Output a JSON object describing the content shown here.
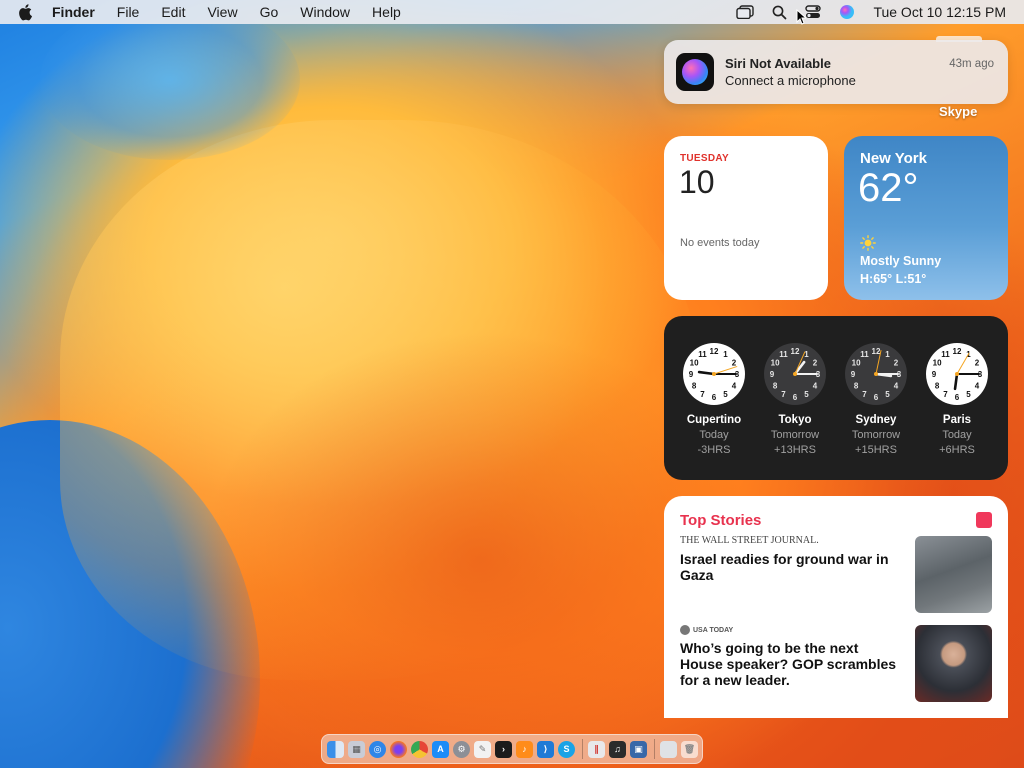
{
  "menubar": {
    "app_name": "Finder",
    "menus": [
      "File",
      "Edit",
      "View",
      "Go",
      "Window",
      "Help"
    ],
    "clock": "Tue Oct 10  12:15 PM"
  },
  "notification": {
    "title": "Siri Not Available",
    "body": "Connect a microphone",
    "time": "43m ago",
    "app_label": "Skype"
  },
  "calendar": {
    "day": "TUESDAY",
    "date": "10",
    "events": "No events today"
  },
  "weather": {
    "city": "New York",
    "temp": "62°",
    "condition": "Mostly Sunny",
    "hilo": "H:65° L:51°"
  },
  "world_clock": [
    {
      "city": "Cupertino",
      "day": "Today",
      "offset": "-3HRS",
      "theme": "light"
    },
    {
      "city": "Tokyo",
      "day": "Tomorrow",
      "offset": "+13HRS",
      "theme": "dark"
    },
    {
      "city": "Sydney",
      "day": "Tomorrow",
      "offset": "+15HRS",
      "theme": "dark"
    },
    {
      "city": "Paris",
      "day": "Today",
      "offset": "+6HRS",
      "theme": "light"
    }
  ],
  "news": {
    "heading": "Top Stories",
    "stories": [
      {
        "source": "THE WALL STREET JOURNAL.",
        "headline": "Israel readies for ground war in Gaza"
      },
      {
        "source": "USA TODAY",
        "headline": "Who’s going to be the next House speaker? GOP scrambles for a new leader."
      }
    ]
  },
  "dock": {
    "apps": [
      "Finder",
      "Launchpad",
      "Safari",
      "Firefox",
      "Chrome",
      "App Store",
      "System Settings",
      "TextEdit",
      "Terminal",
      "GarageBand",
      "VS Code",
      "Skype",
      "Parallels",
      "Piano",
      "VirtualBox",
      "Downloads",
      "Trash"
    ]
  },
  "colors": {
    "accent_red": "#e0322c",
    "news_pink": "#e8324e",
    "weather_blue": "#4a90cc"
  }
}
